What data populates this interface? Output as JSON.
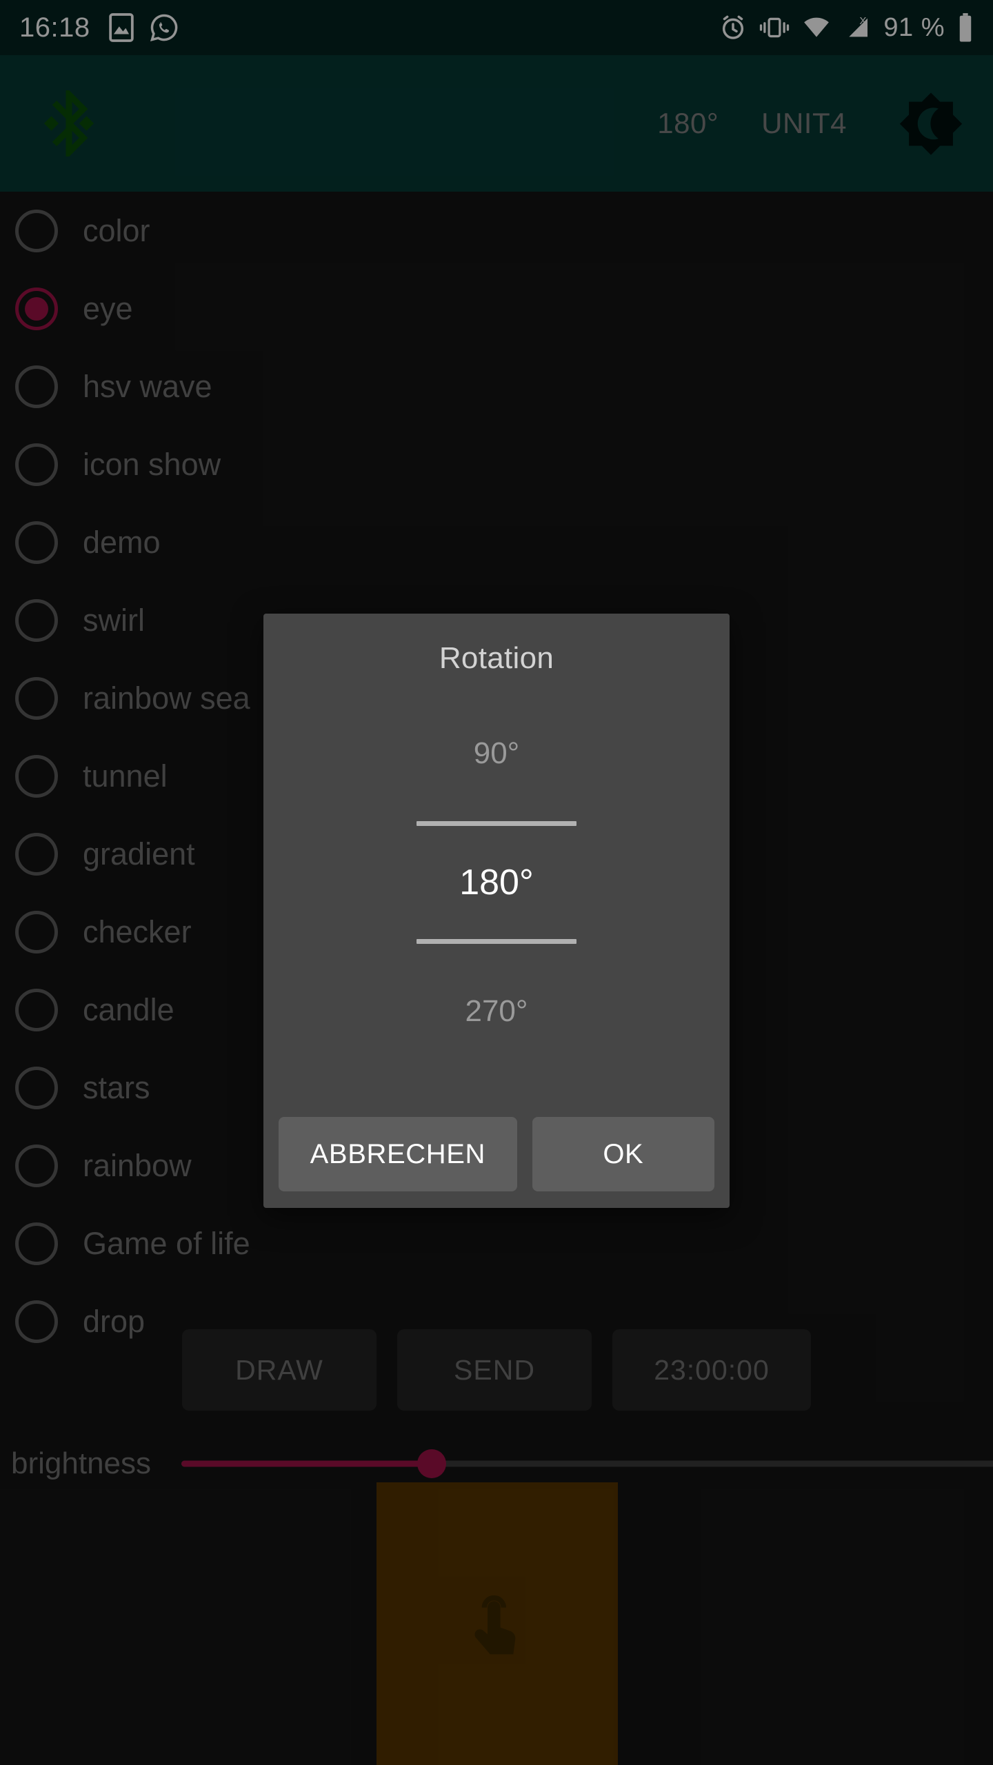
{
  "statusbar": {
    "time": "16:18",
    "battery_percent": "91 %",
    "left_icons": [
      "gallery-icon",
      "whatsapp-icon"
    ],
    "right_icons": [
      "alarm-icon",
      "vibrate-icon",
      "wifi-icon",
      "signal-no-service-icon",
      "battery-icon"
    ],
    "background_color": "#042420"
  },
  "toolbar": {
    "bluetooth_icon": "bluetooth-icon",
    "rotation_value": "180°",
    "unit_label": "UNIT4",
    "theme_toggle_icon": "dark-mode-icon",
    "background_color": "#063733",
    "text_color": "#7d7d7d",
    "bluetooth_color": "#0a4d08"
  },
  "effect_list": {
    "selected": "eye",
    "accent_color": "#9c1245",
    "items": [
      {
        "label": "color",
        "selected": false
      },
      {
        "label": "eye",
        "selected": true
      },
      {
        "label": "hsv wave",
        "selected": false
      },
      {
        "label": "icon show",
        "selected": false
      },
      {
        "label": "demo",
        "selected": false
      },
      {
        "label": "swirl",
        "selected": false
      },
      {
        "label": "rainbow sea",
        "selected": false
      },
      {
        "label": "tunnel",
        "selected": false
      },
      {
        "label": "gradient",
        "selected": false
      },
      {
        "label": "checker",
        "selected": false
      },
      {
        "label": "candle",
        "selected": false
      },
      {
        "label": "stars",
        "selected": false
      },
      {
        "label": "rainbow",
        "selected": false
      },
      {
        "label": "Game of life",
        "selected": false
      },
      {
        "label": "drop",
        "selected": false
      }
    ]
  },
  "actions": {
    "draw_label": "DRAW",
    "send_label": "SEND",
    "time_label": "23:00:00"
  },
  "brightness": {
    "label": "brightness",
    "fill_color": "#9c1245",
    "track_color": "#3a3a3a"
  },
  "canvas": {
    "name": "drawing-canvas",
    "color": "#543300",
    "hint_icon": "touch-pointer-icon"
  },
  "dialog": {
    "title": "Rotation",
    "picker": {
      "previous_value": "90°",
      "selected_value": "180°",
      "next_value": "270°"
    },
    "cancel_label": "ABBRECHEN",
    "ok_label": "OK",
    "background_color": "#464646",
    "button_color": "#5e5e5e"
  }
}
